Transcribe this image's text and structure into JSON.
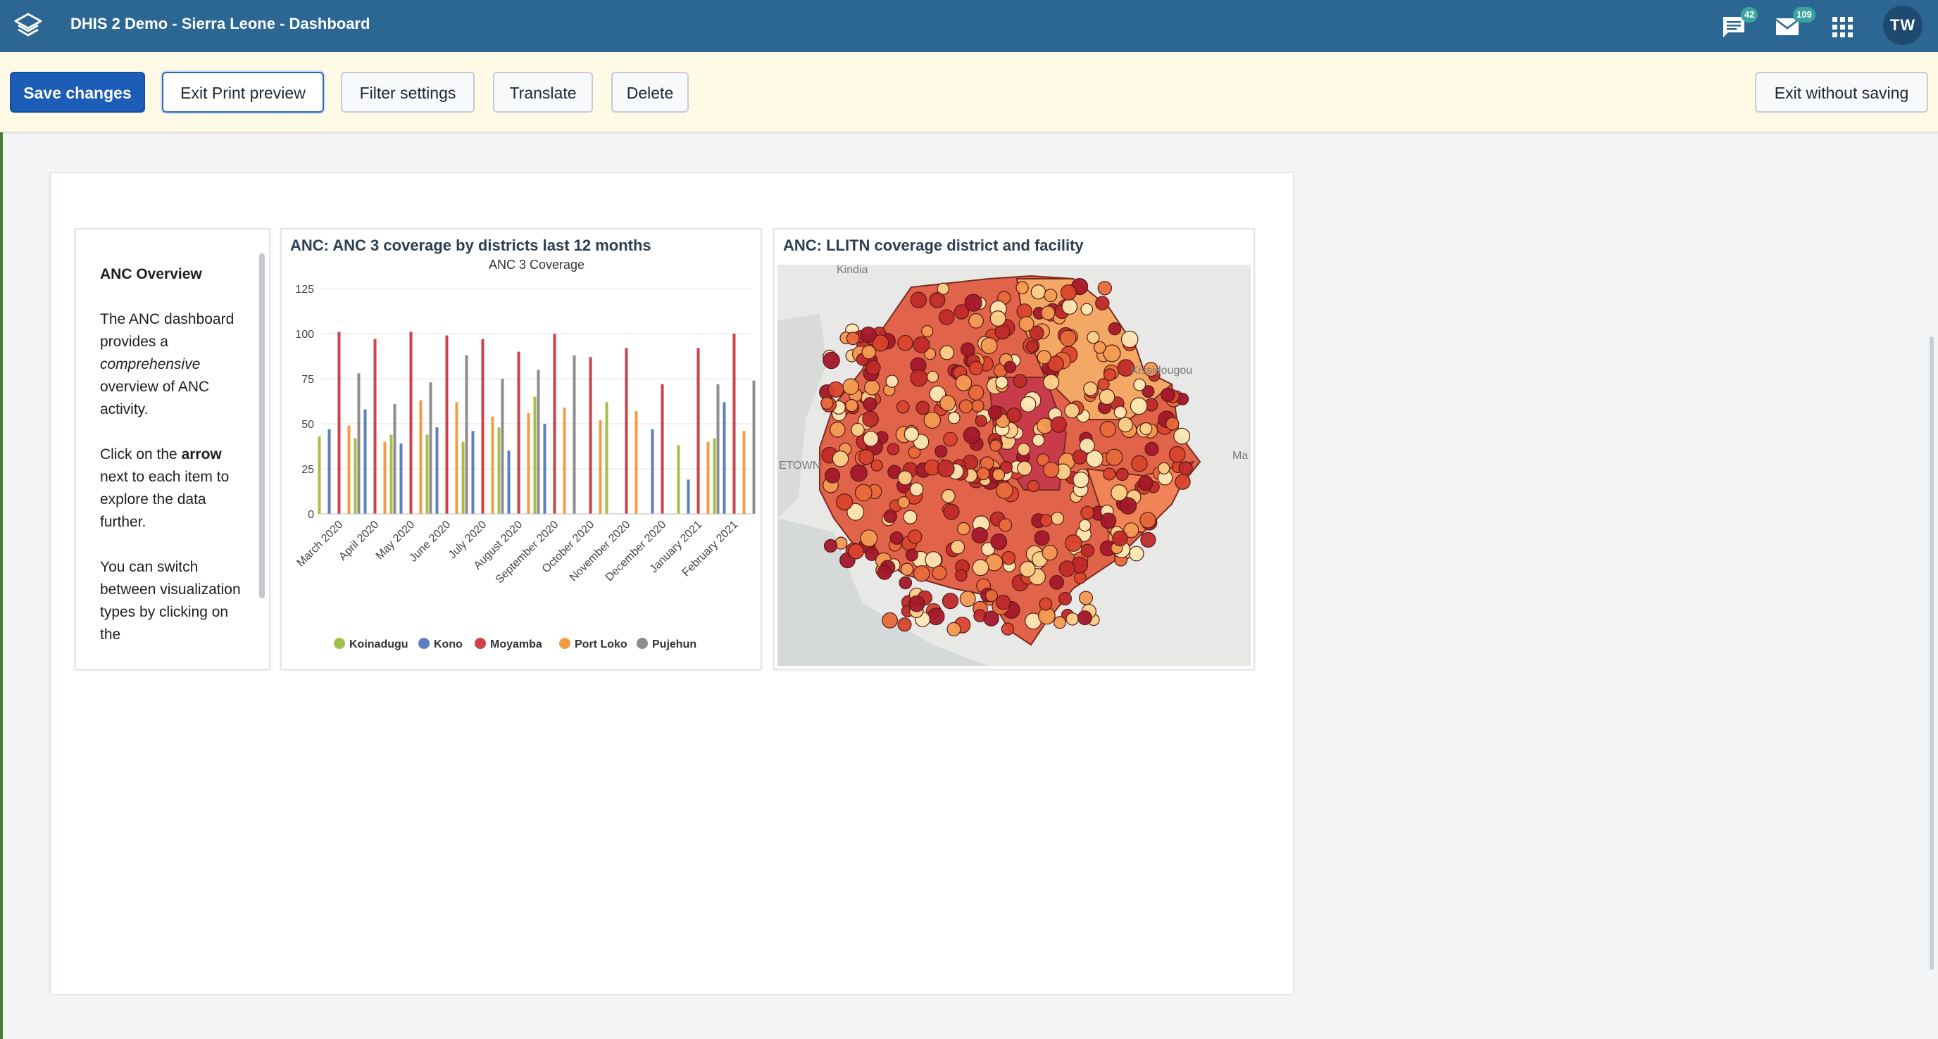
{
  "header": {
    "title": "DHIS 2 Demo - Sierra Leone - Dashboard",
    "messages_count": "42",
    "notifications_count": "109",
    "user_initials": "TW"
  },
  "actions": {
    "save": "Save changes",
    "exit_print": "Exit Print preview",
    "filter": "Filter settings",
    "translate": "Translate",
    "delete": "Delete",
    "exit_without_saving": "Exit without saving"
  },
  "text_item": {
    "heading": "ANC Overview",
    "p1_a": "The ANC dashboard provides a ",
    "p1_em": "comprehensive",
    "p1_b": " overview of ANC activity.",
    "p2_a": "Click on the ",
    "p2_strong": "arrow",
    "p2_b": " next to each item to explore the data further.",
    "p3": "You can switch between visualization types by clicking on the"
  },
  "chart_card": {
    "title": "ANC: ANC 3 coverage by districts last 12 months"
  },
  "map_card": {
    "title": "ANC: LLITN coverage district and facility",
    "labels": [
      "Kindia",
      "Kissidougou",
      "ETOWN",
      "Ma"
    ]
  },
  "colors": {
    "header_bg": "#2c6693",
    "primary_button": "#1c5db8",
    "action_bar_bg": "#fff9e6"
  },
  "chart_data": {
    "type": "bar",
    "title": "ANC 3 Coverage",
    "categories": [
      "March 2020",
      "April 2020",
      "May 2020",
      "June 2020",
      "July 2020",
      "August 2020",
      "September 2020",
      "October 2020",
      "November 2020",
      "December 2020",
      "January 2021",
      "February 2021"
    ],
    "ylim": [
      0,
      125
    ],
    "yticks": [
      0,
      25,
      50,
      75,
      100,
      125
    ],
    "series": [
      {
        "name": "Koinadugu",
        "color": "#a5c04a",
        "values": [
          43,
          42,
          44,
          44,
          40,
          48,
          65,
          null,
          62,
          null,
          38,
          42
        ]
      },
      {
        "name": "Kono",
        "color": "#5b7fbf",
        "values": [
          47,
          58,
          39,
          48,
          46,
          35,
          50,
          null,
          null,
          47,
          19,
          62
        ]
      },
      {
        "name": "Moyamba",
        "color": "#cf4047",
        "values": [
          101,
          97,
          101,
          99,
          97,
          90,
          100,
          87,
          92,
          72,
          92,
          100
        ]
      },
      {
        "name": "Port Loko",
        "color": "#f29d45",
        "values": [
          49,
          40,
          63,
          62,
          54,
          56,
          59,
          52,
          57,
          0,
          40,
          46
        ]
      },
      {
        "name": "Pujehun",
        "color": "#8e8e92",
        "values": [
          78,
          61,
          73,
          88,
          75,
          80,
          88,
          null,
          null,
          null,
          72,
          74
        ]
      }
    ]
  }
}
